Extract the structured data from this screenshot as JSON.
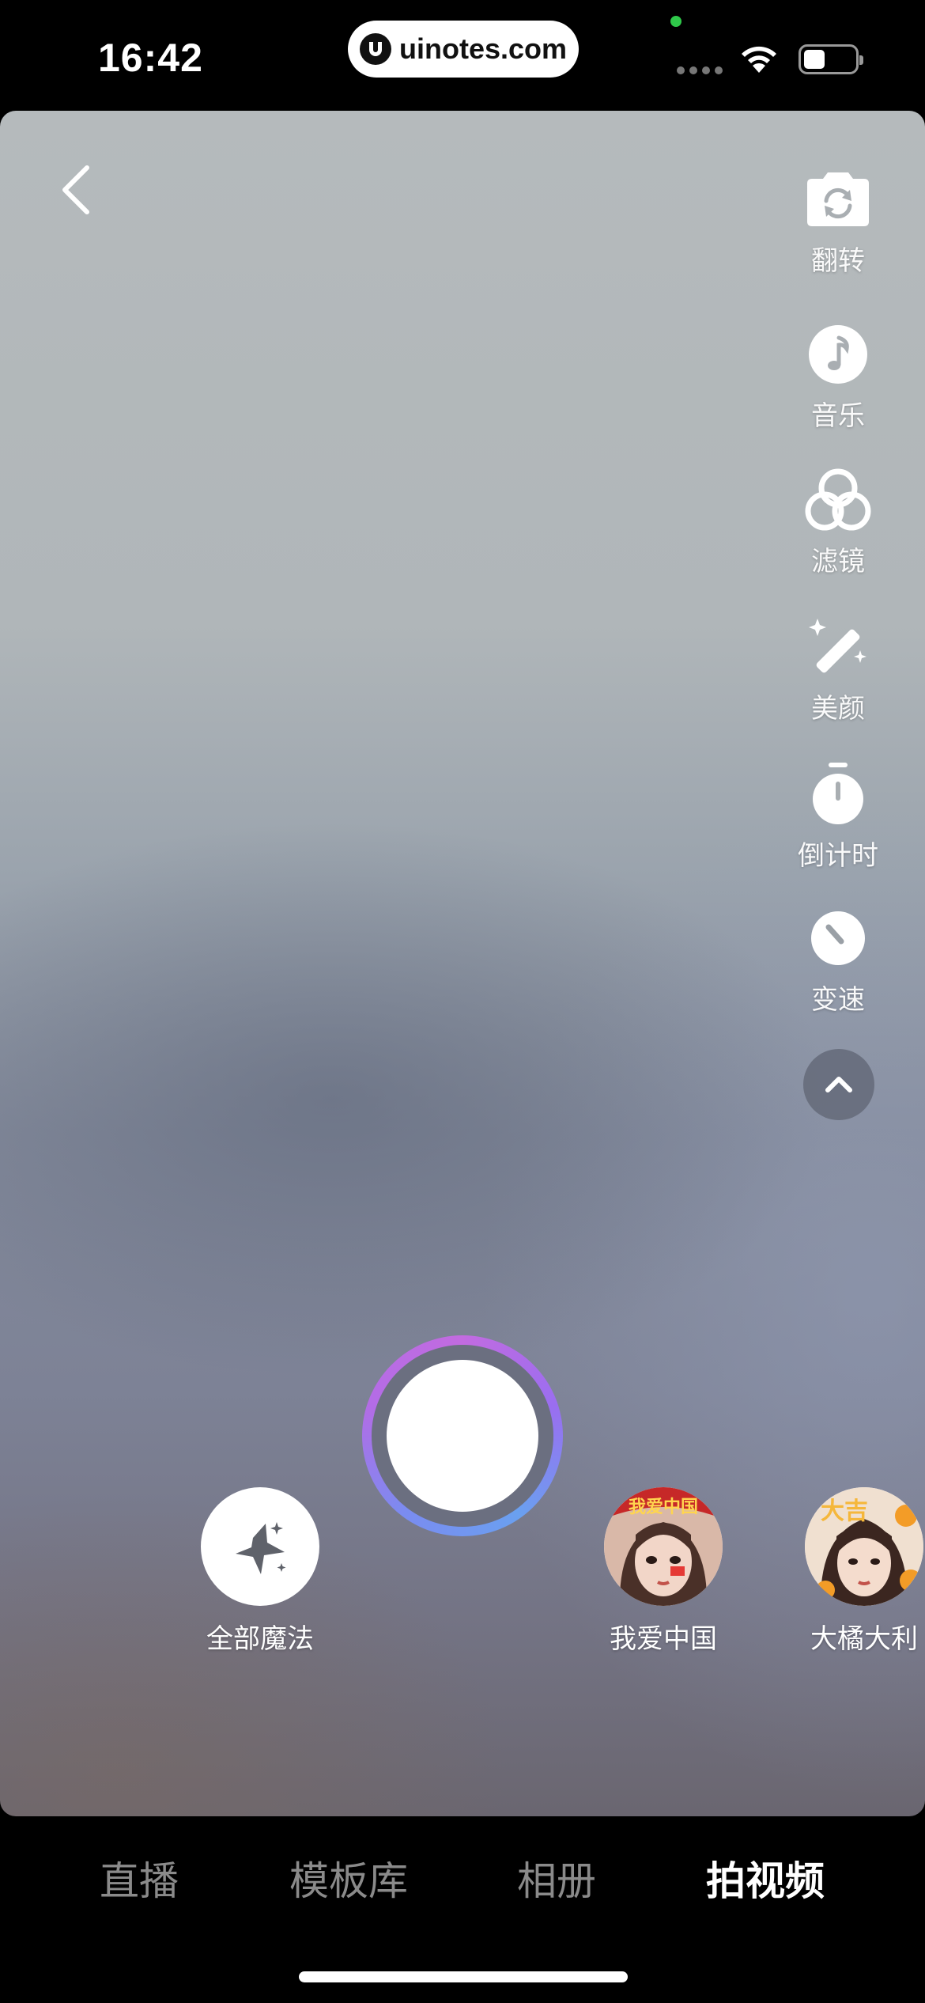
{
  "status_bar": {
    "time": "16:42",
    "url": "uinotes.com",
    "icons": [
      "signal-icon",
      "wifi-icon",
      "battery-icon"
    ]
  },
  "camera": {
    "back_icon": "chevron-left-icon",
    "tools": [
      {
        "label": "翻转",
        "icon": "camera-flip-icon"
      },
      {
        "label": "音乐",
        "icon": "music-note-icon"
      },
      {
        "label": "滤镜",
        "icon": "filter-icon"
      },
      {
        "label": "美颜",
        "icon": "magic-wand-icon"
      },
      {
        "label": "倒计时",
        "icon": "timer-icon"
      },
      {
        "label": "变速",
        "icon": "speed-icon"
      }
    ],
    "collapse_icon": "chevron-up-icon"
  },
  "effects": {
    "all_magic_label": "全部魔法",
    "items": [
      {
        "label": "我爱中国",
        "sticker_text": "我爱中国"
      },
      {
        "label": "大橘大利",
        "sticker_text": "大吉"
      }
    ]
  },
  "tabs": [
    {
      "label": "直播",
      "active": false
    },
    {
      "label": "模板库",
      "active": false
    },
    {
      "label": "相册",
      "active": false
    },
    {
      "label": "拍视频",
      "active": true
    }
  ],
  "colors": {
    "shutter_ring_start": "#c26be0",
    "shutter_ring_end": "#6aa0f0",
    "active_tab": "#ffffff",
    "inactive_tab": "#8a8a8a"
  }
}
